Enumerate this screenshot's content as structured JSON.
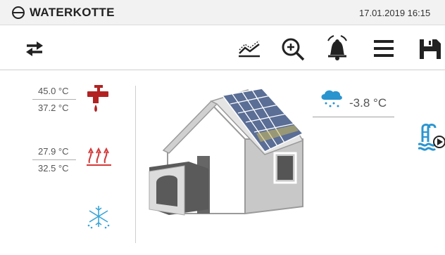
{
  "header": {
    "brand": "WATERKOTTE",
    "datetime": "17.01.2019 16:15"
  },
  "toolbar": {
    "items": [
      {
        "name": "swap-arrows-icon"
      },
      {
        "name": "chart-icon"
      },
      {
        "name": "zoom-in-icon"
      },
      {
        "name": "bell-icon"
      },
      {
        "name": "menu-icon"
      },
      {
        "name": "save-icon"
      }
    ]
  },
  "hot_water": {
    "temp_top": "45.0 °C",
    "temp_bottom": "37.2 °C",
    "icon": "faucet-icon",
    "color": "#b22222"
  },
  "heating": {
    "temp_top": "27.9 °C",
    "temp_bottom": "32.5 °C",
    "icon": "heating-arrows-icon",
    "color": "#d33a3a"
  },
  "cooling": {
    "icon": "snowflake-icon",
    "color": "#39a6d8"
  },
  "outdoor": {
    "temperature": "-3.8 °C",
    "icon": "weather-snow-icon",
    "color": "#2a94cf"
  },
  "pool": {
    "icon": "pool-play-icon",
    "color": "#2a94cf"
  }
}
